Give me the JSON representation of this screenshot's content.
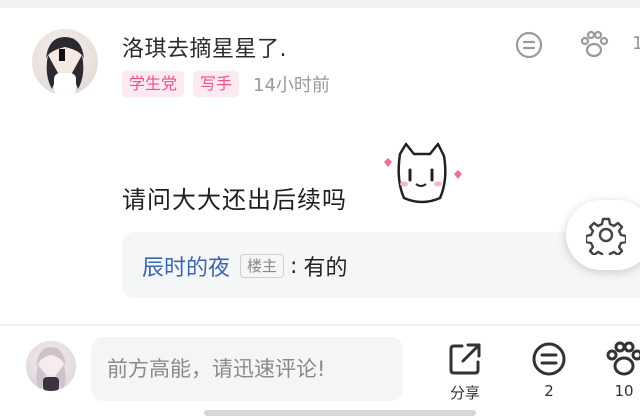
{
  "comment": {
    "username": "洛琪去摘星星了.",
    "badges": [
      "学生党",
      "写手"
    ],
    "time": "14小时前",
    "top_actions": {
      "like_count_partial": "1"
    },
    "text": "请问大大还出后续吗",
    "reply": {
      "user": "辰时的夜",
      "owner_tag": "楼主",
      "separator": ":",
      "content": "有的"
    }
  },
  "bottom_bar": {
    "input_placeholder": "前方高能，请迅速评论!",
    "share_label": "分享",
    "comment_count": "2",
    "like_count": "10"
  },
  "icons": [
    "comment-icon",
    "paw-like-icon",
    "settings-gear-icon",
    "share-icon",
    "cat-sticker"
  ],
  "colors": {
    "badge_bg": "#fde9f1",
    "badge_text": "#e8548a",
    "reply_user": "#3a67b0"
  }
}
